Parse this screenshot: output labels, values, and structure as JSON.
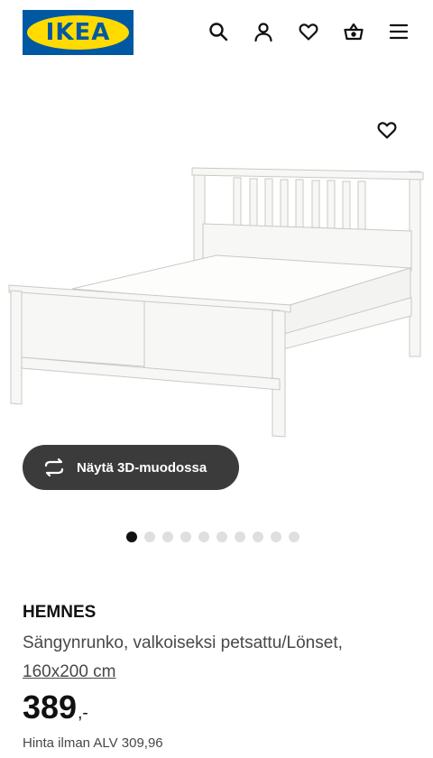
{
  "header": {
    "logo_text": "IKEA",
    "icons": [
      "search-icon",
      "user-icon",
      "heart-icon",
      "basket-icon",
      "menu-icon"
    ]
  },
  "colors": {
    "brand_blue": "#0058a3",
    "brand_yellow": "#ffdb00",
    "button_dark": "#3b3b3b",
    "dot_active": "#111111",
    "dot_inactive": "#dfdfdf"
  },
  "gallery": {
    "view_3d_label": "Näytä 3D-muodossa",
    "total_images": 10,
    "active_index": 0
  },
  "product": {
    "name": "HEMNES",
    "description": "Sängynrunko, valkoiseksi petsattu/Lönset,",
    "size": "160x200 cm",
    "price_integer": "389",
    "price_suffix": ",-",
    "price_excl_vat": "Hinta ilman ALV 309,96"
  }
}
